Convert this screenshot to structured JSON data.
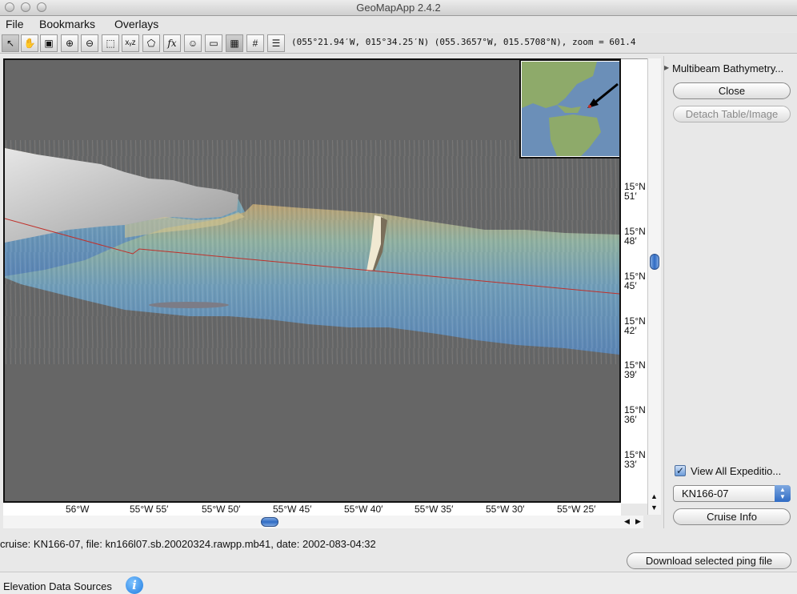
{
  "window": {
    "title": "GeoMapApp 2.4.2"
  },
  "menu": {
    "items": [
      "File",
      "Bookmarks",
      "Overlays"
    ]
  },
  "toolbar": {
    "tools": [
      {
        "name": "select-tool-icon",
        "glyph": "↖"
      },
      {
        "name": "pan-hand-icon",
        "glyph": "✋"
      },
      {
        "name": "save-icon",
        "glyph": "▣"
      },
      {
        "name": "zoom-in-icon",
        "glyph": "⊕"
      },
      {
        "name": "zoom-out-icon",
        "glyph": "⊖"
      },
      {
        "name": "rectangle-select-icon",
        "glyph": "⬚"
      },
      {
        "name": "xyz-profile-icon",
        "glyph": "xᵧz"
      },
      {
        "name": "polygon-draw-icon",
        "glyph": "⬠"
      },
      {
        "name": "function-icon",
        "glyph": "fx"
      },
      {
        "name": "globe-icon",
        "glyph": "☺"
      },
      {
        "name": "frame-icon",
        "glyph": "▭"
      },
      {
        "name": "grid-icon",
        "glyph": "▦"
      },
      {
        "name": "nasa-grid-icon",
        "glyph": "#"
      },
      {
        "name": "layers-list-icon",
        "glyph": "☰"
      }
    ],
    "coords": "(055°21.94′W, 015°34.25′N) (055.3657°W, 015.5708°N), zoom = 601.4"
  },
  "map": {
    "y_labels": [
      {
        "text": "15°N\n51′"
      },
      {
        "text": "15°N\n48′"
      },
      {
        "text": "15°N\n45′"
      },
      {
        "text": "15°N\n42′"
      },
      {
        "text": "15°N\n39′"
      },
      {
        "text": "15°N\n36′"
      },
      {
        "text": "15°N\n33′"
      }
    ],
    "x_labels": [
      "56°W",
      "55°W 55′",
      "55°W 50′",
      "55°W 45′",
      "55°W 40′",
      "55°W 35′",
      "55°W 30′",
      "55°W 25′"
    ]
  },
  "panel": {
    "title": "Multibeam Bathymetry...",
    "close_label": "Close",
    "detach_label": "Detach Table/Image",
    "view_all_label": "View All Expeditio...",
    "view_all_checked": true,
    "cruise_selected": "KN166-07",
    "cruise_info_label": "Cruise Info"
  },
  "status": {
    "text": "cruise: KN166-07, file: kn166l07.sb.20020324.rawpp.mb41, date: 2002-083-04:32",
    "download_label": "Download selected ping file"
  },
  "bottom": {
    "elevation_label": "Elevation Data Sources",
    "info_glyph": "i"
  },
  "colors": {
    "map_background": "#666666",
    "track_line": "#c0302a",
    "accent": "#2f6bc4"
  }
}
